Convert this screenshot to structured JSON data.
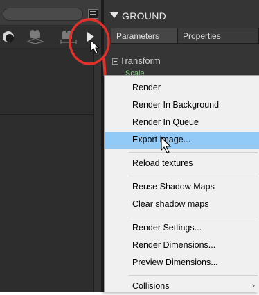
{
  "panel": {
    "object_name": "GROUND",
    "tabs": [
      "Parameters",
      "Properties"
    ],
    "section_title": "Transform",
    "property_label": "Scale"
  },
  "context_menu": {
    "groups": [
      [
        "Render",
        "Render In Background",
        "Render In Queue",
        "Export image..."
      ],
      [
        "Reload textures"
      ],
      [
        "Reuse Shadow Maps",
        "Clear shadow maps"
      ],
      [
        "Render Settings...",
        "Render Dimensions...",
        "Preview Dimensions..."
      ],
      [
        "Collisions"
      ]
    ],
    "highlighted_item": "Export image...",
    "submenu_item": "Collisions"
  },
  "colors": {
    "annotation": "#e0312a",
    "menu_highlight": "#91c9f7",
    "property_text": "#7fd67f"
  },
  "icons": [
    "sphere-icon",
    "camera-icon",
    "camera-plane-icon",
    "film-camera-icon",
    "play-arrow-icon",
    "mouse-pointer-icon"
  ]
}
